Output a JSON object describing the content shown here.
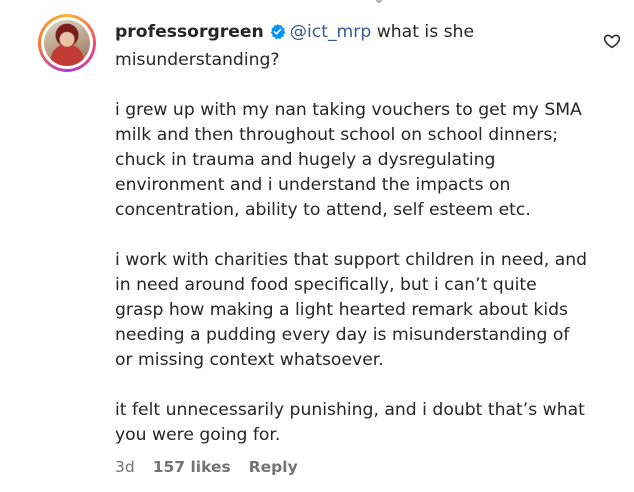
{
  "comment": {
    "username": "professorgreen",
    "mention": "@ict_mrp",
    "first_line_rest": " what is she misunderstanding?",
    "paragraphs": [
      "i grew up with my nan taking vouchers to get my SMA\nmilk and then throughout school on school dinners;\nchuck in trauma and hugely a dysregulating\nenvironment and i understand the impacts on\nconcentration, ability to attend, self esteem etc.",
      "i work with charities that support children in need, and\nin need around food specifically, but i can’t quite\ngrasp how making a light hearted remark about kids\nneeding a pudding every day is misunderstanding of\nor missing context whatsoever.",
      "it felt unnecessarily punishing, and i doubt that’s what\nyou were going for."
    ],
    "time": "3d",
    "likes": "157 likes",
    "reply_label": "Reply",
    "icons": {
      "verified": "verified-badge-icon",
      "like": "heart-outline-icon"
    },
    "colors": {
      "text": "#262626",
      "mention": "#3a5a92",
      "meta": "#737373",
      "verified": "#0095f6"
    }
  }
}
